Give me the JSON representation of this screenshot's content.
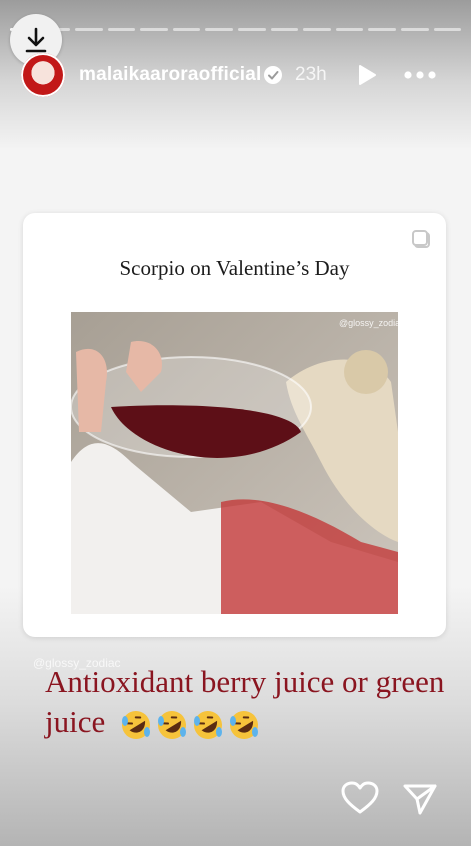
{
  "story": {
    "username": "malaikaaroraofficial",
    "time": "23h",
    "segments": 14,
    "active_segment": 0
  },
  "icons": {
    "download": "download-icon",
    "verified": "verified-badge-icon",
    "play": "play-icon",
    "more": "more-icon",
    "like": "heart-icon",
    "share": "send-icon",
    "repost": "repost-icon"
  },
  "post": {
    "title": "Scorpio on Valentine’s Day",
    "photo_watermark": "@glossy_zodiac"
  },
  "caption": {
    "watermark": "@glossy_zodiac",
    "text": "Antioxidant berry juice or green juice",
    "emoji_count": 4
  },
  "colors": {
    "caption": "#8a1520",
    "wine": "#5d0f17"
  }
}
